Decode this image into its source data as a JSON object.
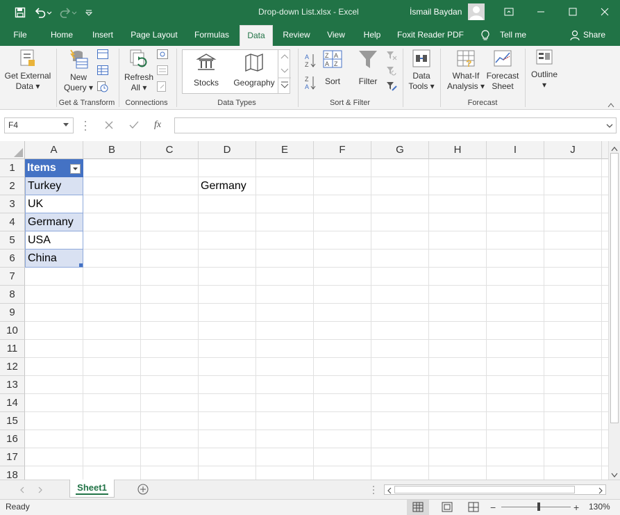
{
  "window": {
    "document_title": "Drop-down List.xlsx  -  Excel",
    "user_name": "İsmail Baydan"
  },
  "menu": {
    "tabs": [
      "File",
      "Home",
      "Insert",
      "Page Layout",
      "Formulas",
      "Data",
      "Review",
      "View",
      "Help",
      "Foxit Reader PDF",
      "Tell me",
      "Share"
    ],
    "active_tab": "Data"
  },
  "ribbon": {
    "get_external_data": [
      "Get External",
      "Data"
    ],
    "new_query": [
      "New",
      "Query"
    ],
    "refresh_all": [
      "Refresh",
      "All"
    ],
    "stocks": "Stocks",
    "geography": "Geography",
    "sort": "Sort",
    "filter": "Filter",
    "data_tools": [
      "Data",
      "Tools"
    ],
    "what_if": [
      "What-If",
      "Analysis"
    ],
    "forecast_sheet": [
      "Forecast",
      "Sheet"
    ],
    "outline": "Outline",
    "groups": {
      "get_transform": "Get & Transform",
      "connections": "Connections",
      "data_types": "Data Types",
      "sort_filter": "Sort & Filter",
      "forecast": "Forecast"
    }
  },
  "formula_bar": {
    "name_box": "F4",
    "formula": "",
    "fx": "fx"
  },
  "columns": [
    "A",
    "B",
    "C",
    "D",
    "E",
    "F",
    "G",
    "H",
    "I",
    "J"
  ],
  "rows": [
    "1",
    "2",
    "3",
    "4",
    "5",
    "6",
    "7",
    "8",
    "9",
    "10",
    "11",
    "12",
    "13",
    "14",
    "15",
    "16",
    "17",
    "18"
  ],
  "cells": {
    "A1": "Items",
    "A2": "Turkey",
    "A3": "UK",
    "A4": "Germany",
    "A5": "USA",
    "A6": "China",
    "D2": "Germany"
  },
  "colors": {
    "excel_green": "#217346",
    "table_header": "#4472c4",
    "table_band": "#d9e1f2"
  },
  "sheets": [
    "Sheet1"
  ],
  "status": {
    "ready": "Ready",
    "zoom": "130%"
  }
}
